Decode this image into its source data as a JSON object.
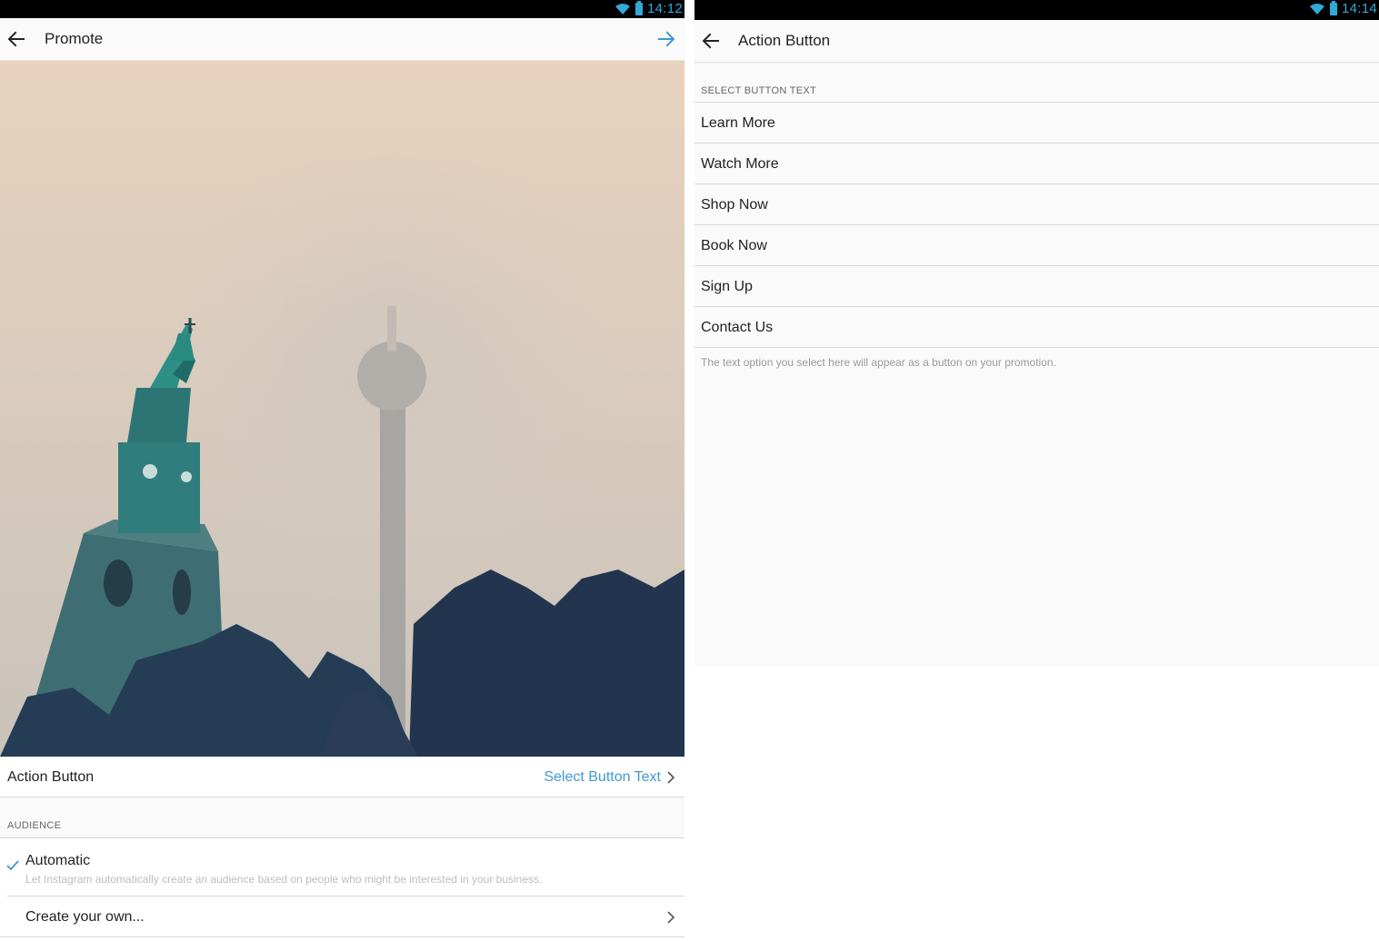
{
  "left_screen": {
    "status": {
      "time": "14:12"
    },
    "app_bar": {
      "title": "Promote"
    },
    "photo": {
      "description_icon": "photo-placeholder-icon"
    },
    "action_row": {
      "label": "Action Button",
      "value": "Select Button Text"
    },
    "audience": {
      "header": "AUDIENCE",
      "automatic": {
        "title": "Automatic",
        "description": "Let Instagram automatically create an audience based on people who might be interested in your business."
      },
      "create_own": {
        "title": "Create your own..."
      }
    }
  },
  "right_screen": {
    "status": {
      "time": "14:14"
    },
    "app_bar": {
      "title": "Action Button"
    },
    "section_header": "SELECT BUTTON TEXT",
    "options": [
      {
        "label": "Learn More"
      },
      {
        "label": "Watch More"
      },
      {
        "label": "Shop Now"
      },
      {
        "label": "Book Now"
      },
      {
        "label": "Sign Up"
      },
      {
        "label": "Contact Us"
      }
    ],
    "hint": "The text option you select here will appear as a button on your promotion."
  },
  "colors": {
    "accent": "#3f98d4",
    "status_accent": "#31a9d9"
  }
}
